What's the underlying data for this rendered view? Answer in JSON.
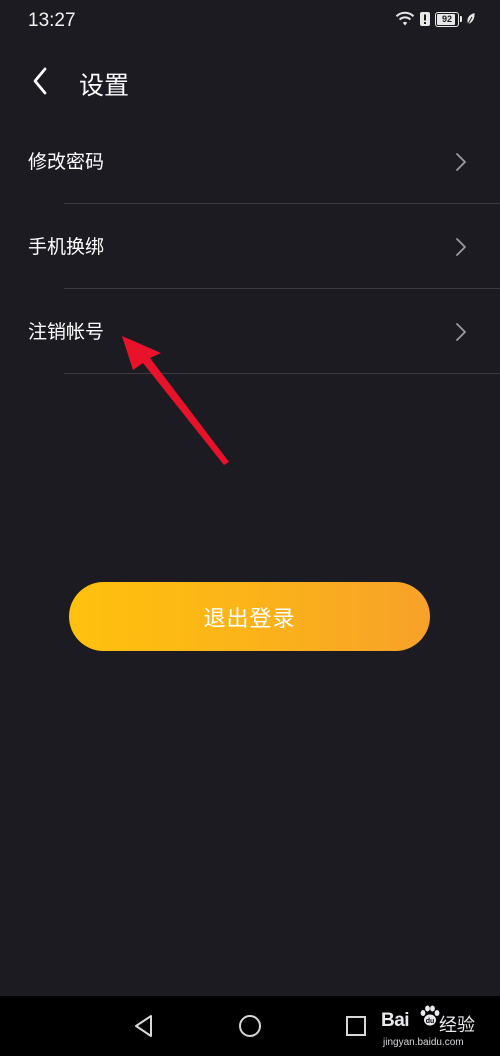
{
  "status_bar": {
    "time": "13:27",
    "battery_level": "92",
    "battery_fraction": 0.92,
    "icons": [
      "wifi-icon",
      "alert-icon",
      "battery-icon",
      "leaf-icon"
    ]
  },
  "header": {
    "title": "设置",
    "back_icon": "chevron-left-icon"
  },
  "menu": {
    "items": [
      {
        "label": "修改密码",
        "icon": "chevron-right-icon"
      },
      {
        "label": "手机换绑",
        "icon": "chevron-right-icon"
      },
      {
        "label": "注销帐号",
        "icon": "chevron-right-icon"
      }
    ]
  },
  "logout": {
    "label": "退出登录",
    "gradient_start": "#ffc10d",
    "gradient_end": "#f7a12a"
  },
  "annotation": {
    "color": "#e8132a"
  },
  "nav_bar": {
    "icons": [
      "back-triangle-icon",
      "home-circle-icon",
      "recents-square-icon"
    ]
  },
  "watermark": {
    "logo": "Bai",
    "logo_suffix": "经验",
    "url": "jingyan.baidu.com"
  },
  "colors": {
    "background": "#1c1b21",
    "divider": "#3a3940",
    "text": "#ffffff"
  }
}
